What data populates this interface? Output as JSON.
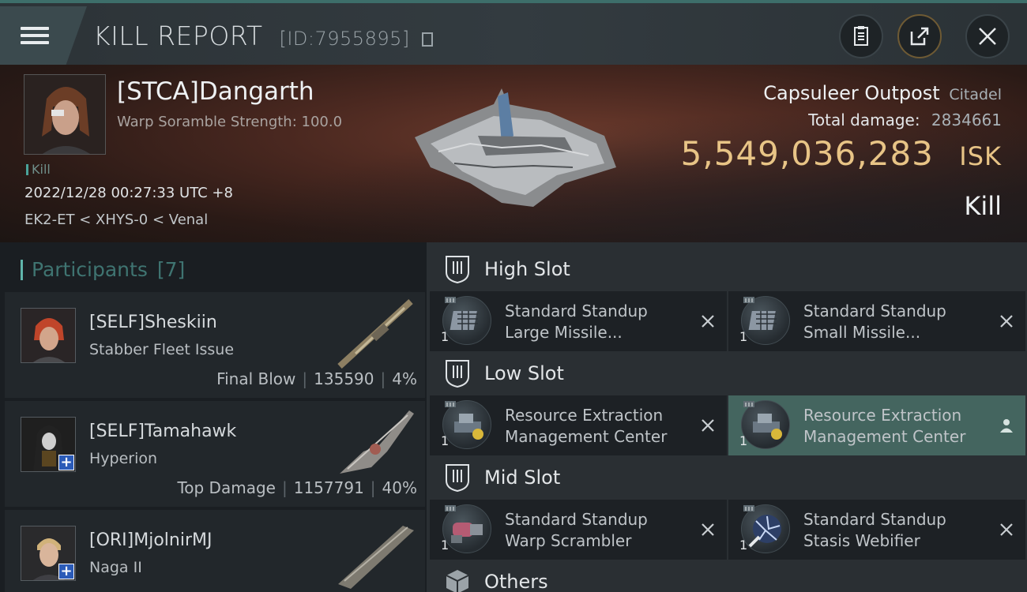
{
  "window": {
    "title": "KILL REPORT",
    "report_id": "[ID:7955895]"
  },
  "victim": {
    "name": "[STCA]Dangarth",
    "subtitle": "Warp Soramble Strength: 100.0",
    "tag": "Kill",
    "datetime": "2022/12/28 00:27:33 UTC +8",
    "location": "EK2-ET < XHYS-0 < Venal"
  },
  "target": {
    "name": "Capsuleer Outpost",
    "type": "Citadel",
    "damage_label": "Total damage:",
    "damage_value": "2834661",
    "isk_value": "5,549,036,283",
    "isk_unit": "ISK",
    "outcome": "Kill"
  },
  "participants": {
    "header": "Participants",
    "count": "[7]",
    "rows": [
      {
        "name": "[SELF]Sheskiin",
        "ship": "Stabber Fleet Issue",
        "role": "Final Blow",
        "damage": "135590",
        "percent": "4%"
      },
      {
        "name": "[SELF]Tamahawk",
        "ship": "Hyperion",
        "role": "Top Damage",
        "damage": "1157791",
        "percent": "40%"
      },
      {
        "name": "[ORI]MjolnirMJ",
        "ship": "Naga II"
      }
    ]
  },
  "fitting": {
    "high": {
      "title": "High Slot",
      "modules": [
        {
          "line1": "Standard Standup",
          "line2": "Large Missile...",
          "qty": "1"
        },
        {
          "line1": "Standard Standup",
          "line2": "Small Missile...",
          "qty": "1"
        }
      ]
    },
    "low": {
      "title": "Low Slot",
      "modules": [
        {
          "line1": "Resource Extraction",
          "line2": "Management Center",
          "qty": "1"
        },
        {
          "line1": "Resource Extraction",
          "line2": "Management Center",
          "qty": "1"
        }
      ]
    },
    "mid": {
      "title": "Mid Slot",
      "modules": [
        {
          "line1": "Standard Standup",
          "line2": "Warp Scrambler",
          "qty": "1"
        },
        {
          "line1": "Standard Standup",
          "line2": "Stasis Webifier",
          "qty": "1"
        }
      ]
    },
    "others": {
      "title": "Others"
    }
  },
  "colors": {
    "isk": "#e8c486",
    "accent": "#5fb5ab",
    "active_module": "#44655f"
  },
  "icons": [
    "menu-icon",
    "copy-icon",
    "clipboard-icon",
    "share-icon",
    "close-icon",
    "high-slot-icon",
    "low-slot-icon",
    "mid-slot-icon",
    "cube-icon",
    "destroyed-x-icon",
    "pilot-icon"
  ]
}
